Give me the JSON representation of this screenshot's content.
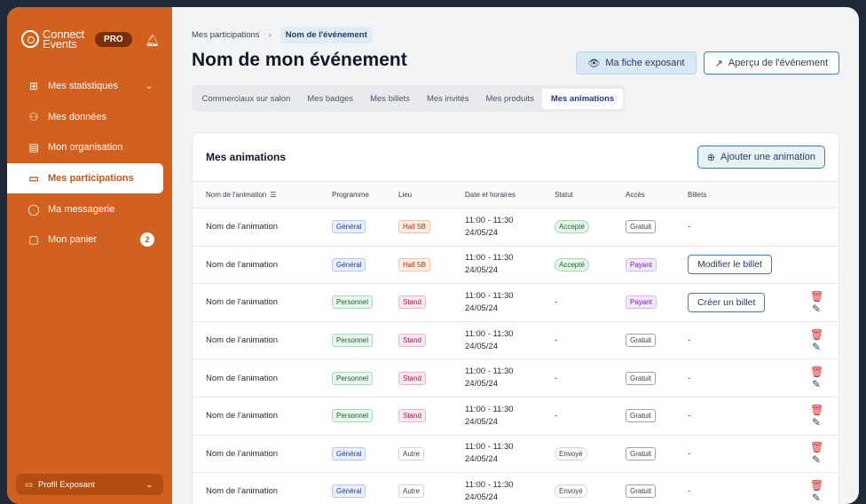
{
  "sidebar": {
    "brand": {
      "line1": "Connect",
      "line2": "Events",
      "plan": "PRO"
    },
    "items": [
      {
        "label": "Mes statistiques",
        "icon": "grid-icon",
        "glyph": "⊞",
        "chevron": "⌄"
      },
      {
        "label": "Mes données",
        "icon": "users-icon",
        "glyph": "⚇"
      },
      {
        "label": "Mon organisation",
        "icon": "store-icon",
        "glyph": "▤"
      },
      {
        "label": "Mes participations",
        "icon": "presentation-icon",
        "glyph": "▭"
      },
      {
        "label": "Ma messagerie",
        "icon": "chat-icon",
        "glyph": "◯"
      },
      {
        "label": "Mon panier",
        "icon": "bag-icon",
        "glyph": "▢",
        "count": "2"
      }
    ],
    "profile": {
      "label": "Profil Exposant"
    }
  },
  "breadcrumb": {
    "parent": "Mes participations",
    "current": "Nom de l'événement"
  },
  "page": {
    "title": "Nom de mon événement"
  },
  "actions": {
    "fiche": "Ma fiche exposant",
    "apercu": "Aperçu de l'événement"
  },
  "tabs": [
    "Commerciaux sur salon",
    "Mes badges",
    "Mes billets",
    "Mes invités",
    "Mes produits",
    "Mes animations"
  ],
  "card": {
    "title": "Mes animations",
    "add_button": "Ajouter une animation",
    "columns": [
      "Nom de l'animation",
      "Programme",
      "Lieu",
      "Date et horaires",
      "Statut",
      "Accès",
      "Billets"
    ],
    "rows": [
      {
        "name": "Nom de l'animation",
        "programme": "Général",
        "lieu": "Hall 5B",
        "time": "11:00 - 11:30",
        "date": "24/05/24",
        "statut": "Accepté",
        "acces": "Gratuit",
        "billets": "-",
        "billet_btn": "",
        "actions": false
      },
      {
        "name": "Nom de l'animation",
        "programme": "Général",
        "lieu": "Hall 5B",
        "time": "11:00 - 11:30",
        "date": "24/05/24",
        "statut": "Accepté",
        "acces": "Payant",
        "billets": "",
        "billet_btn": "Modifier le billet",
        "actions": false
      },
      {
        "name": "Nom de l'animation",
        "programme": "Personnel",
        "lieu": "Stand",
        "time": "11:00 - 11:30",
        "date": "24/05/24",
        "statut": "-",
        "acces": "Payant",
        "billets": "",
        "billet_btn": "Créer un billet",
        "actions": true
      },
      {
        "name": "Nom de l'animation",
        "programme": "Personnel",
        "lieu": "Stand",
        "time": "11:00 - 11:30",
        "date": "24/05/24",
        "statut": "-",
        "acces": "Gratuit",
        "billets": "-",
        "billet_btn": "",
        "actions": true
      },
      {
        "name": "Nom de l'animation",
        "programme": "Personnel",
        "lieu": "Stand",
        "time": "11:00 - 11:30",
        "date": "24/05/24",
        "statut": "-",
        "acces": "Gratuit",
        "billets": "-",
        "billet_btn": "",
        "actions": true
      },
      {
        "name": "Nom de l'animation",
        "programme": "Personnel",
        "lieu": "Stand",
        "time": "11:00 - 11:30",
        "date": "24/05/24",
        "statut": "-",
        "acces": "Gratuit",
        "billets": "-",
        "billet_btn": "",
        "actions": true
      },
      {
        "name": "Nom de l'animation",
        "programme": "Général",
        "lieu": "Autre",
        "time": "11:00 - 11:30",
        "date": "24/05/24",
        "statut": "Envoyé",
        "acces": "Gratuit",
        "billets": "-",
        "billet_btn": "",
        "actions": true
      },
      {
        "name": "Nom de l'animation",
        "programme": "Général",
        "lieu": "Autre",
        "time": "11:00 - 11:30",
        "date": "24/05/24",
        "statut": "Envoyé",
        "acces": "Gratuit",
        "billets": "-",
        "billet_btn": "",
        "actions": true
      }
    ]
  },
  "colors": {
    "sidebar": "#d2611f",
    "accent": "#3b7fbf",
    "danger": "#dc2626"
  }
}
